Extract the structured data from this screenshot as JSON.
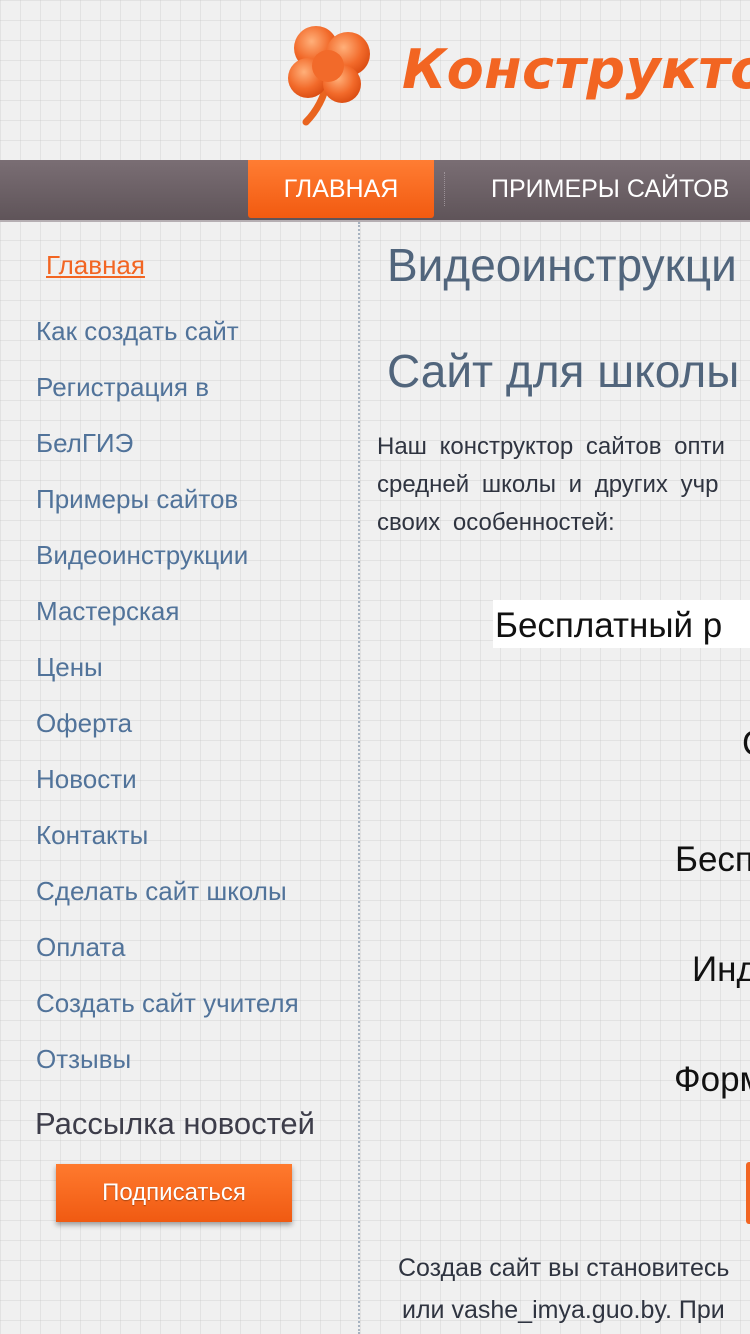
{
  "header": {
    "logo_text": "Конструктор"
  },
  "nav": {
    "active_label": "ГЛАВНАЯ",
    "item2_label": "ПРИМЕРЫ САЙТОВ"
  },
  "sidebar": {
    "home_label": "Главная",
    "links": [
      "Как создать сайт",
      "Регистрация в",
      "БелГИЭ",
      "Примеры сайтов",
      "Видеоинструкции",
      "Мастерская",
      "Цены",
      "Оферта",
      "Новости",
      "Контакты",
      "Сделать сайт школы",
      "Оплата",
      "Создать сайт учителя",
      "Отзывы"
    ],
    "newsletter_title": "Рассылка новостей",
    "subscribe_label": "Подписаться"
  },
  "content": {
    "heading1": "Видеоинструкци",
    "heading2": "Сайт для школы",
    "paragraph": [
      "Наш конструктор сайтов  опти",
      "средней школы и других учр",
      "своих особенностей:"
    ],
    "features": [
      "Бесплатный р",
      "С",
      "Бесп",
      "Инд",
      "Форм"
    ],
    "bottom_lines": [
      "Создав сайт вы становитесь",
      "или vashe_imya.guo.by. При"
    ]
  },
  "colors": {
    "accent": "#f26522",
    "nav_bg": "#6b6065",
    "link": "#51739a",
    "heading": "#51657c"
  },
  "icons": {
    "logo": "clover-icon"
  }
}
